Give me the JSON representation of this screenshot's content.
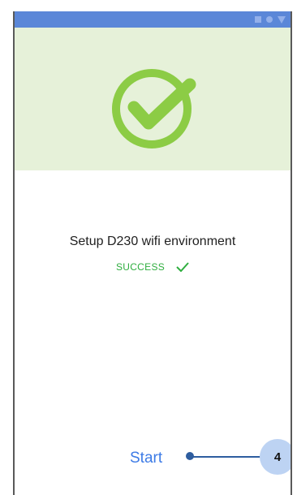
{
  "status_bar": {
    "icons": [
      "square-icon",
      "circle-icon",
      "triangle-icon"
    ],
    "color": "#5b87d8"
  },
  "hero": {
    "icon": "check-circle-icon",
    "background": "#e6f1d9",
    "icon_color": "#8ccc45"
  },
  "main": {
    "title": "Setup D230 wifi environment",
    "status": "SUCCESS",
    "status_icon": "checkmark-icon",
    "status_color": "#2fae3f"
  },
  "footer": {
    "start_label": "Start"
  },
  "annotation": {
    "badge": "4"
  }
}
